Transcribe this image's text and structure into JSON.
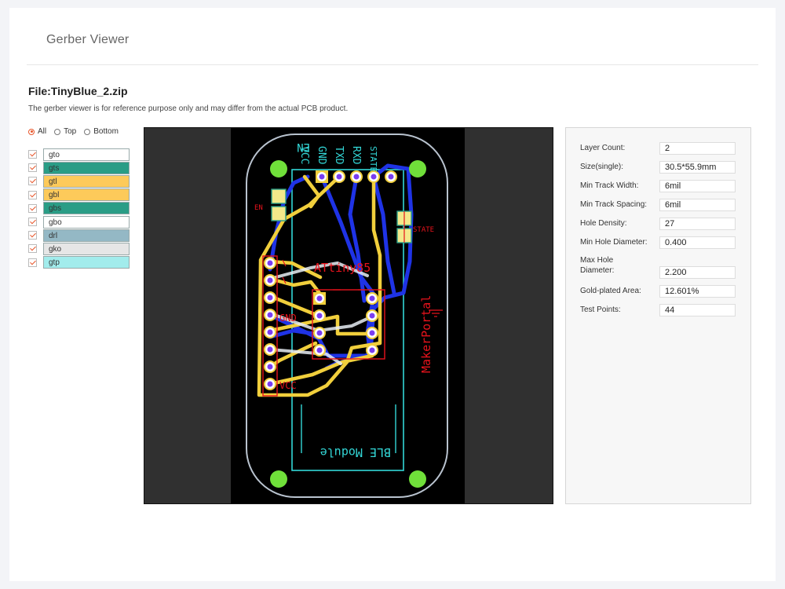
{
  "header": {
    "title": "Gerber Viewer"
  },
  "file": {
    "title": "File:TinyBlue_2.zip",
    "disclaimer": "The gerber viewer is for reference purpose only and may differ from the actual PCB product."
  },
  "view_mode": {
    "options": [
      {
        "label": "All",
        "selected": true
      },
      {
        "label": "Top",
        "selected": false
      },
      {
        "label": "Bottom",
        "selected": false
      }
    ]
  },
  "layers": [
    {
      "name": "gto",
      "checked": true,
      "color": "#ffffff"
    },
    {
      "name": "gts",
      "checked": true,
      "color": "#2a9d86"
    },
    {
      "name": "gtl",
      "checked": true,
      "color": "#fdca5a"
    },
    {
      "name": "gbl",
      "checked": true,
      "color": "#fdca5a"
    },
    {
      "name": "gbs",
      "checked": true,
      "color": "#2a9d86"
    },
    {
      "name": "gbo",
      "checked": true,
      "color": "#ffffff"
    },
    {
      "name": "drl",
      "checked": true,
      "color": "#94b8c5"
    },
    {
      "name": "gko",
      "checked": true,
      "color": "#e6e6e6"
    },
    {
      "name": "gtp",
      "checked": true,
      "color": "#a2ecec"
    }
  ],
  "board": {
    "silkscreen_labels": [
      "EN",
      "VCC",
      "GND",
      "TXD",
      "RXD",
      "STATE",
      "EN",
      "STATE",
      "ATtiny85",
      "MakerPortal",
      "BLE Module",
      "VCC",
      "GND"
    ],
    "colors": {
      "trace_top": "#f1cf3c",
      "trace_bottom": "#1f33e6",
      "silk": "#e8131c",
      "outline": "#33d7d7",
      "pad": "#f1cf3c",
      "drill": "#7a3df0",
      "mount_hole": "#70e03a"
    }
  },
  "info": {
    "rows": [
      {
        "label": "Layer Count:",
        "value": "2"
      },
      {
        "label": "Size(single):",
        "value": "30.5*55.9mm"
      },
      {
        "label": "Min Track Width:",
        "value": "6mil"
      },
      {
        "label": "Min Track Spacing:",
        "value": "6mil"
      },
      {
        "label": "Hole Density:",
        "value": "27"
      },
      {
        "label": "Min Hole Diameter:",
        "value": "0.400"
      },
      {
        "label": "Max Hole Diameter:",
        "value": "2.200"
      },
      {
        "label": "Gold-plated Area:",
        "value": "12.601%"
      },
      {
        "label": "Test Points:",
        "value": "44"
      }
    ]
  }
}
